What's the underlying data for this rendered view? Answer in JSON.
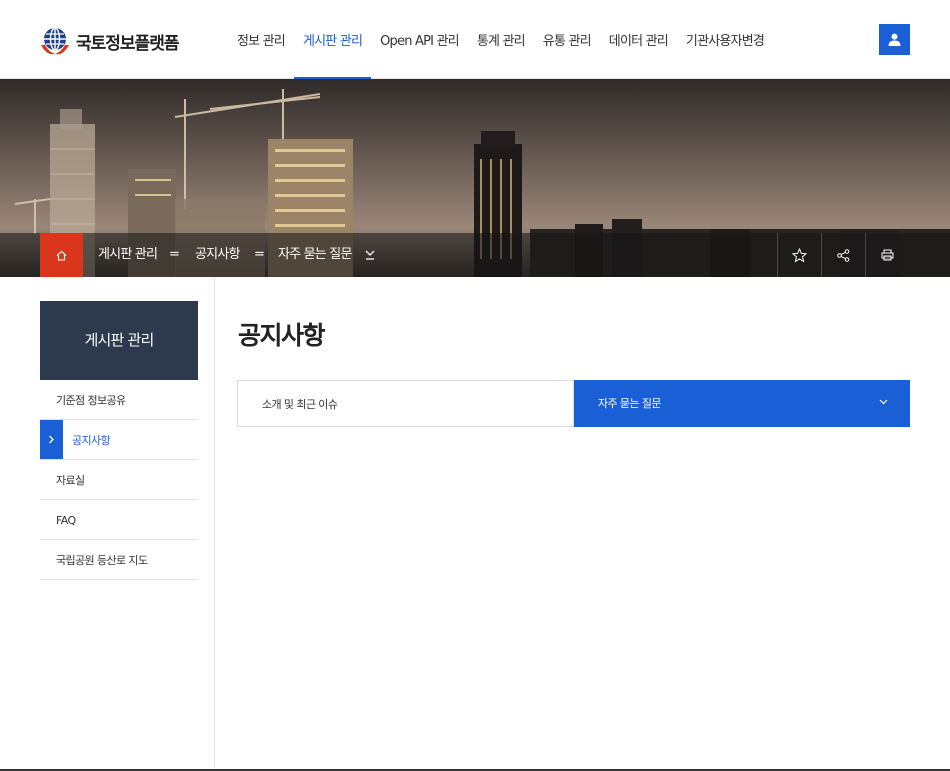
{
  "header": {
    "logo_text": "국토정보플랫폼",
    "nav": [
      {
        "label": "정보 관리",
        "active": false
      },
      {
        "label": "게시판 관리",
        "active": true
      },
      {
        "label": "Open API 관리",
        "active": false
      },
      {
        "label": "통계 관리",
        "active": false
      },
      {
        "label": "유통 관리",
        "active": false
      },
      {
        "label": "데이터 관리",
        "active": false
      },
      {
        "label": "기관사용자변경",
        "active": false
      }
    ],
    "user_icon": "user-icon"
  },
  "location": {
    "home_icon": "home-icon",
    "crumbs": [
      "게시판 관리",
      "공지사항",
      "자주 묻는 질문"
    ],
    "separator": "=",
    "utils": [
      "star-icon",
      "share-icon",
      "print-icon"
    ]
  },
  "sidebar": {
    "title": "게시판 관리",
    "items": [
      {
        "label": "기준점 정보공유",
        "active": false
      },
      {
        "label": "공지사항",
        "active": true
      },
      {
        "label": "자료실",
        "active": false
      },
      {
        "label": "FAQ",
        "active": false
      },
      {
        "label": "국립공원 등산로 지도",
        "active": false
      }
    ]
  },
  "main": {
    "title": "공지사항",
    "tabs": [
      {
        "label": "소개 및 최근 이슈",
        "active": false
      },
      {
        "label": "자주 묻는 질문",
        "active": true
      }
    ]
  },
  "colors": {
    "accent": "#1a5fd6",
    "home": "#d9361c",
    "sidebar_title_bg": "#2d3a4d"
  }
}
